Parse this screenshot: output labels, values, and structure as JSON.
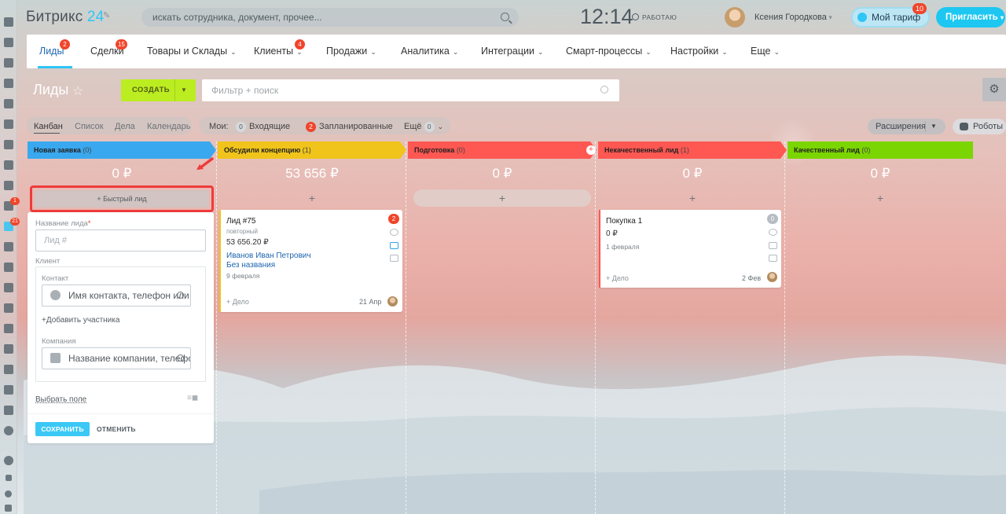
{
  "header": {
    "logo_name": "Битрикс",
    "logo_num": "24",
    "search_placeholder": "искать сотрудника, документ, прочее...",
    "clock": "12:14",
    "work_status": "РАБОТАЮ",
    "user_name": "Ксения Городкова",
    "tarif_label": "Мой тариф",
    "tarif_badge": "10",
    "invite_label": "Пригласить"
  },
  "leftbar": {
    "badges": [
      "1",
      "21"
    ]
  },
  "menu": [
    {
      "label": "Лиды",
      "badge": "2",
      "dropdown": false,
      "active": true
    },
    {
      "label": "Сделки",
      "badge": "15",
      "dropdown": false
    },
    {
      "label": "Товары и Склады",
      "badge": "",
      "dropdown": true
    },
    {
      "label": "Клиенты",
      "badge": "4",
      "dropdown": true
    },
    {
      "label": "Продажи",
      "badge": "",
      "dropdown": true
    },
    {
      "label": "Аналитика",
      "badge": "",
      "dropdown": true
    },
    {
      "label": "Интеграции",
      "badge": "",
      "dropdown": true
    },
    {
      "label": "Смарт-процессы",
      "badge": "",
      "dropdown": true
    },
    {
      "label": "Настройки",
      "badge": "",
      "dropdown": true
    },
    {
      "label": "Еще",
      "badge": "",
      "dropdown": true
    }
  ],
  "toolbar": {
    "page_title": "Лиды",
    "create_label": "СОЗДАТЬ",
    "filter_placeholder": "Фильтр + поиск"
  },
  "views": {
    "kanban": "Канбан",
    "list": "Список",
    "activities": "Дела",
    "calendar": "Календарь",
    "mine_label": "Мои:",
    "incoming_count": "0",
    "incoming_label": "Входящие",
    "planned_count": "2",
    "planned_label": "Запланированные",
    "more_label": "Ещё",
    "more_count": "0",
    "extensions_label": "Расширения",
    "robots_label": "Роботы"
  },
  "stages": [
    {
      "name": "Новая заявка",
      "count": "(0)",
      "sum": "0 ₽",
      "color": "#39a8ef"
    },
    {
      "name": "Обсудили концепцию",
      "count": "(1)",
      "sum": "53 656 ₽",
      "color": "#f0c41a"
    },
    {
      "name": "Подготовка",
      "count": "(0)",
      "sum": "0 ₽",
      "color": "#ff5752"
    },
    {
      "name": "Некачественный лид",
      "count": "(1)",
      "sum": "0 ₽",
      "color": "#ff5752"
    },
    {
      "name": "Качественный лид",
      "count": "(0)",
      "sum": "0 ₽",
      "color": "#7bd500"
    }
  ],
  "quick_lead": {
    "button_label": "+ Быстрый лид",
    "name_label": "Название лида",
    "required_mark": "*",
    "name_placeholder": "Лид #",
    "client_label": "Кл­иент",
    "contact_label": "Контакт",
    "contact_placeholder": "Имя контакта, телефон или",
    "add_participant": "+Добавить участника",
    "company_label": "Компания",
    "company_placeholder": "Название компании, телефо",
    "choose_field": "Выбрать поле",
    "save_label": "СОХРАНИТЬ",
    "cancel_label": "ОТМЕНИТЬ"
  },
  "cards": [
    {
      "title": "Лид #75",
      "subtitle": "повторный",
      "amount": "53 656.20 ₽",
      "contact": "Иванов Иван Петрович",
      "company": "Без названия",
      "date": "9 февраля",
      "badge": "2",
      "deal_label": "+ Дело",
      "deal_date": "21 Апр"
    },
    {
      "title": "Покупка 1",
      "amount": "0 ₽",
      "date": "1 февраля",
      "badge": "0",
      "deal_label": "+ Дело",
      "deal_date": "2 Фев"
    }
  ],
  "colors": {
    "accent": "#2fc6f6",
    "create_green": "#bbed21",
    "badge_red": "#f0452b",
    "highlight_red": "#ef3b3b"
  }
}
